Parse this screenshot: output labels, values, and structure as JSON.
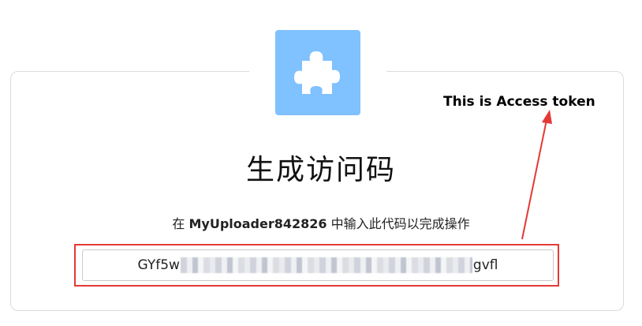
{
  "icon": {
    "name": "puzzle-piece-icon",
    "bg_color": "#80c1ff"
  },
  "dialog": {
    "title": "生成访问码",
    "subtitle_prefix": "在 ",
    "app_name": "MyUploader842826",
    "subtitle_suffix": " 中输入此代码以完成操作",
    "token_start": "GYf5w",
    "token_end": "gvfl"
  },
  "annotation": {
    "text": "This is Access token",
    "color": "#e53935"
  }
}
